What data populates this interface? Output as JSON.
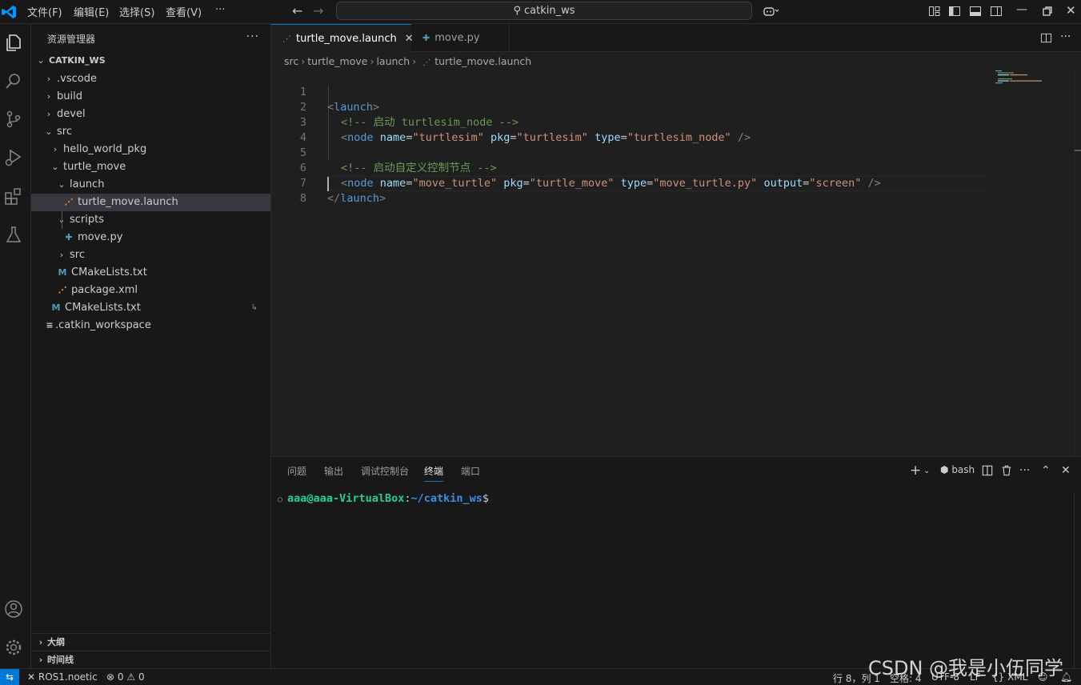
{
  "titlebar": {
    "menus": [
      "文件(F)",
      "编辑(E)",
      "选择(S)",
      "查看(V)",
      "···"
    ],
    "search_text": "catkin_ws"
  },
  "sidebar": {
    "title": "资源管理器",
    "more": "···",
    "root": "CATKIN_WS",
    "items": [
      {
        "label": ".vscode"
      },
      {
        "label": "build"
      },
      {
        "label": "devel"
      },
      {
        "label": "src"
      },
      {
        "label": "hello_world_pkg"
      },
      {
        "label": "turtle_move"
      },
      {
        "label": "launch"
      },
      {
        "label": "turtle_move.launch"
      },
      {
        "label": "scripts"
      },
      {
        "label": "move.py"
      },
      {
        "label": "src"
      },
      {
        "label": "CMakeLists.txt"
      },
      {
        "label": "package.xml"
      },
      {
        "label": "CMakeLists.txt"
      },
      {
        "label": ".catkin_workspace"
      }
    ],
    "outline": "大纲",
    "timeline": "时间线"
  },
  "tabs": [
    {
      "label": "turtle_move.launch",
      "active": true
    },
    {
      "label": "move.py",
      "active": false
    }
  ],
  "breadcrumb": [
    "src",
    "turtle_move",
    "launch",
    "turtle_move.launch"
  ],
  "editor": {
    "line_numbers": [
      "1",
      "2",
      "3",
      "4",
      "5",
      "6",
      "7",
      "8"
    ],
    "lines": [
      {
        "t": "<",
        "tag": "launch",
        "e": ">"
      },
      {
        "comment": "<!-- 启动 turtlesim_node -->"
      },
      {
        "tag": "node",
        "a1": "name",
        "v1": "\"turtlesim\"",
        "a2": "pkg",
        "v2": "\"turtlesim\"",
        "a3": "type",
        "v3": "\"turtlesim_node\"",
        "close": " />"
      },
      {},
      {
        "comment": "<!-- 启动自定义控制节点 -->"
      },
      {
        "tag": "node",
        "a1": "name",
        "v1": "\"move_turtle\"",
        "a2": "pkg",
        "v2": "\"turtle_move\"",
        "a3": "type",
        "v3": "\"move_turtle.py\"",
        "a4": "output",
        "v4": "\"screen\"",
        "close": " />"
      },
      {
        "tag": "launch"
      }
    ]
  },
  "panel": {
    "tabs": [
      "问题",
      "输出",
      "调试控制台",
      "终端",
      "端口"
    ],
    "active_tab": "终端",
    "shell": "bash",
    "prompt_user": "aaa@aaa-VirtualBox",
    "prompt_sep": ":",
    "prompt_path": "~/catkin_ws",
    "prompt_symbol": "$"
  },
  "statusbar": {
    "remote": "ROS1.noetic",
    "errors": "0",
    "warnings": "0",
    "position": "行 8，列 1",
    "spaces": "空格: 4",
    "encoding": "UTF-8",
    "eol": "LF",
    "language": "XML"
  },
  "watermark": "CSDN @我是小伍同学",
  "colors": {
    "accent": "#0078d4",
    "xml_icon": "#e37933",
    "python_icon": "#519aba",
    "cmake_icon": "#519aba"
  }
}
